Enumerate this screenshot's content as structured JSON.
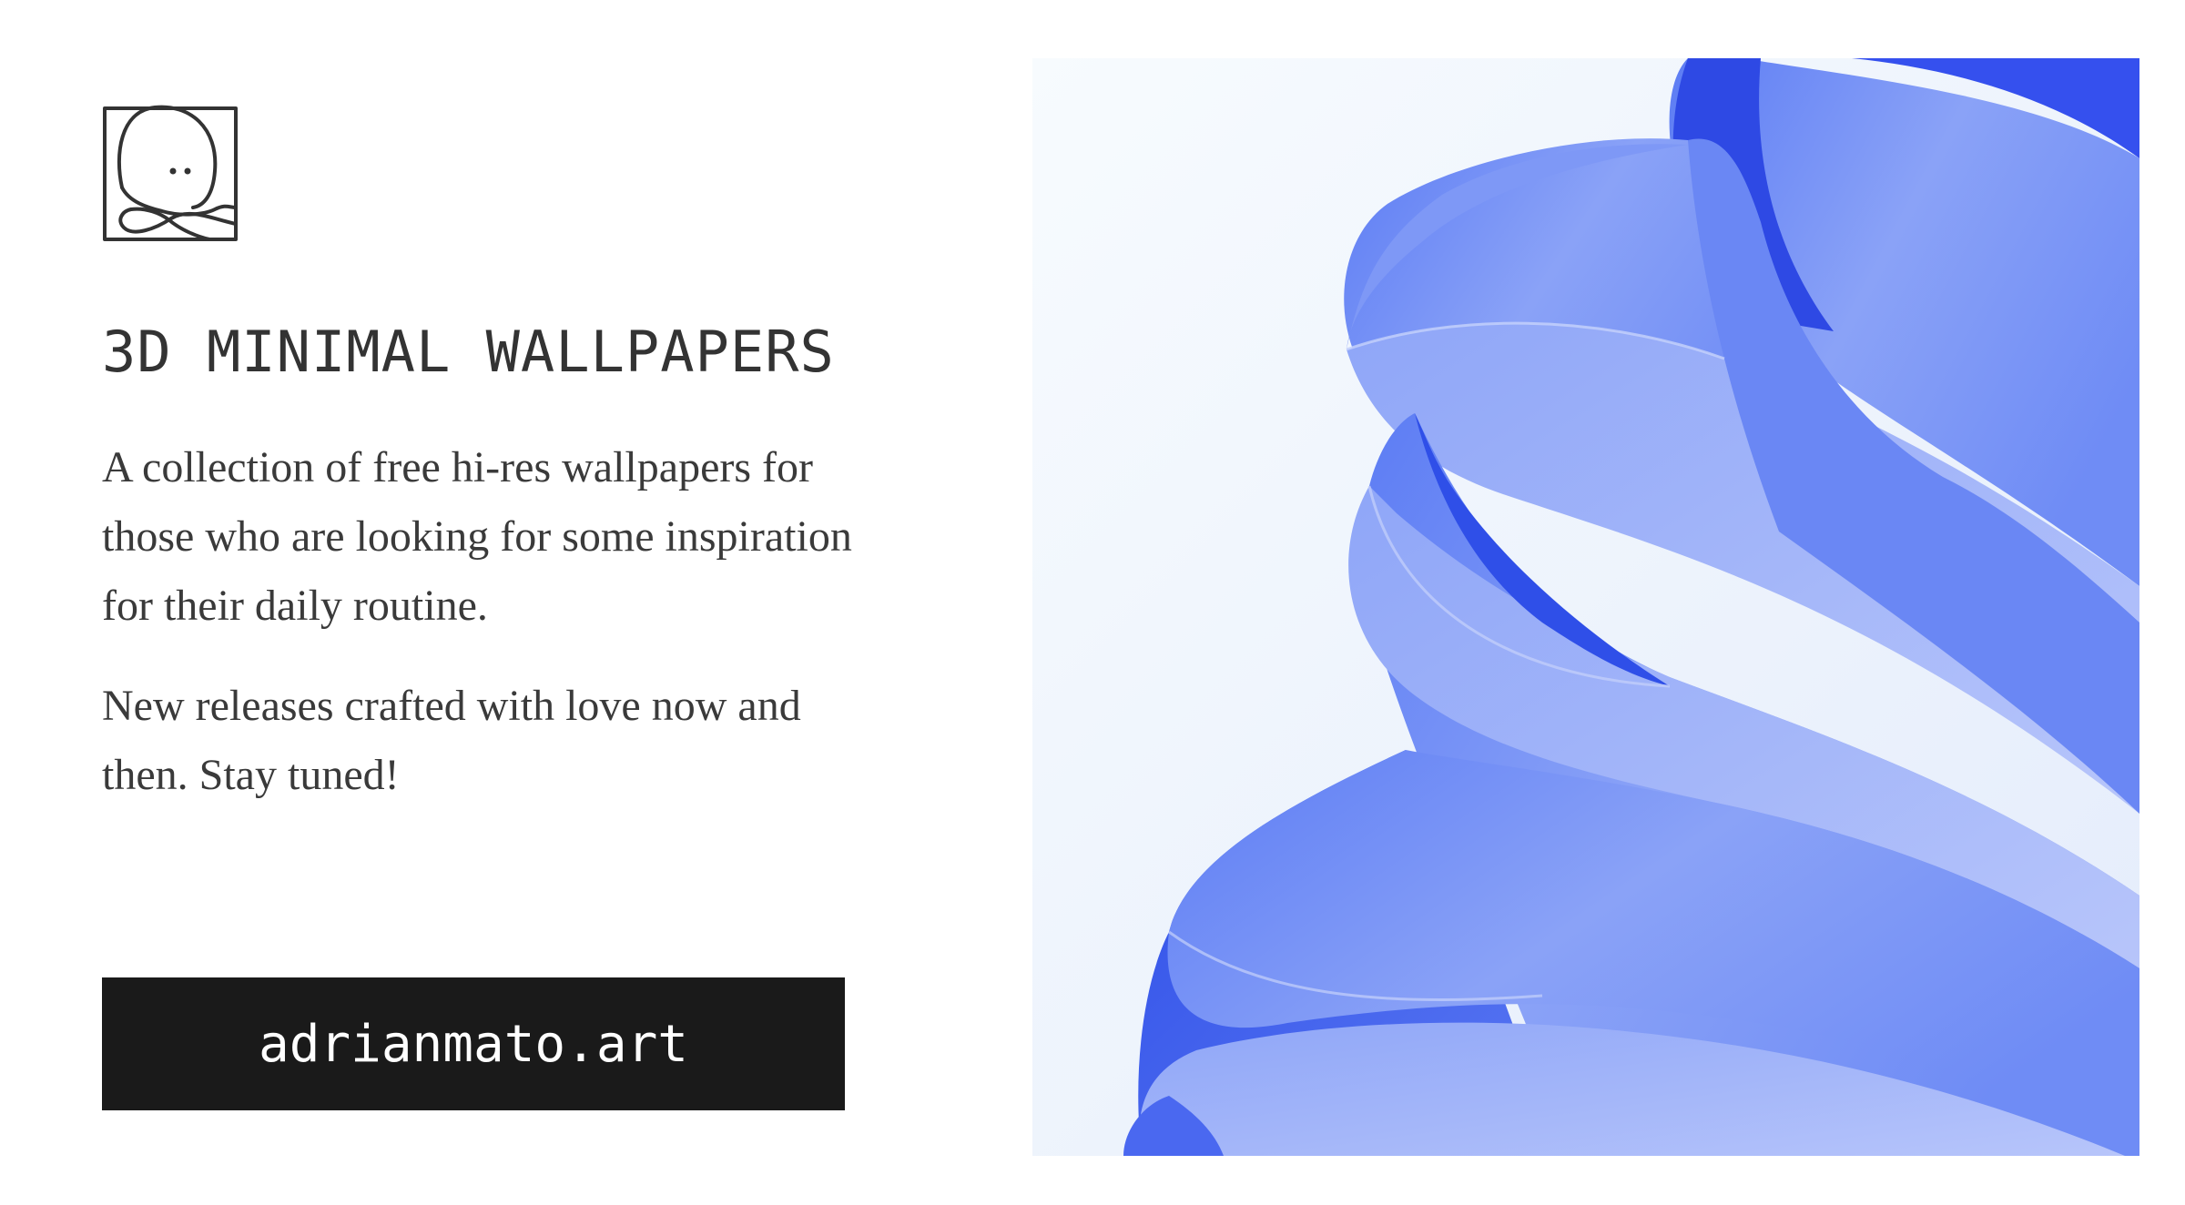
{
  "logo": {
    "icon": "octopus-logo-icon",
    "color": "#333333"
  },
  "title": "3D MINIMAL WALLPAPERS",
  "description": {
    "paragraph_1": "A collection of free hi-res wallpapers for those who are looking for some inspiration for their daily routine.",
    "paragraph_2": "New releases crafted with love now and then. Stay tuned!"
  },
  "cta": {
    "label": "adrianmato.art",
    "background": "#1a1a1a",
    "text_color": "#ffffff"
  },
  "artwork": {
    "subject": "blue-folded-ribbon-wallpaper",
    "colors": {
      "background": "#f3f7fc",
      "ribbon_dark": "#3f5ff0",
      "ribbon_mid": "#6f8cf5",
      "ribbon_light": "#a9baf8"
    }
  }
}
